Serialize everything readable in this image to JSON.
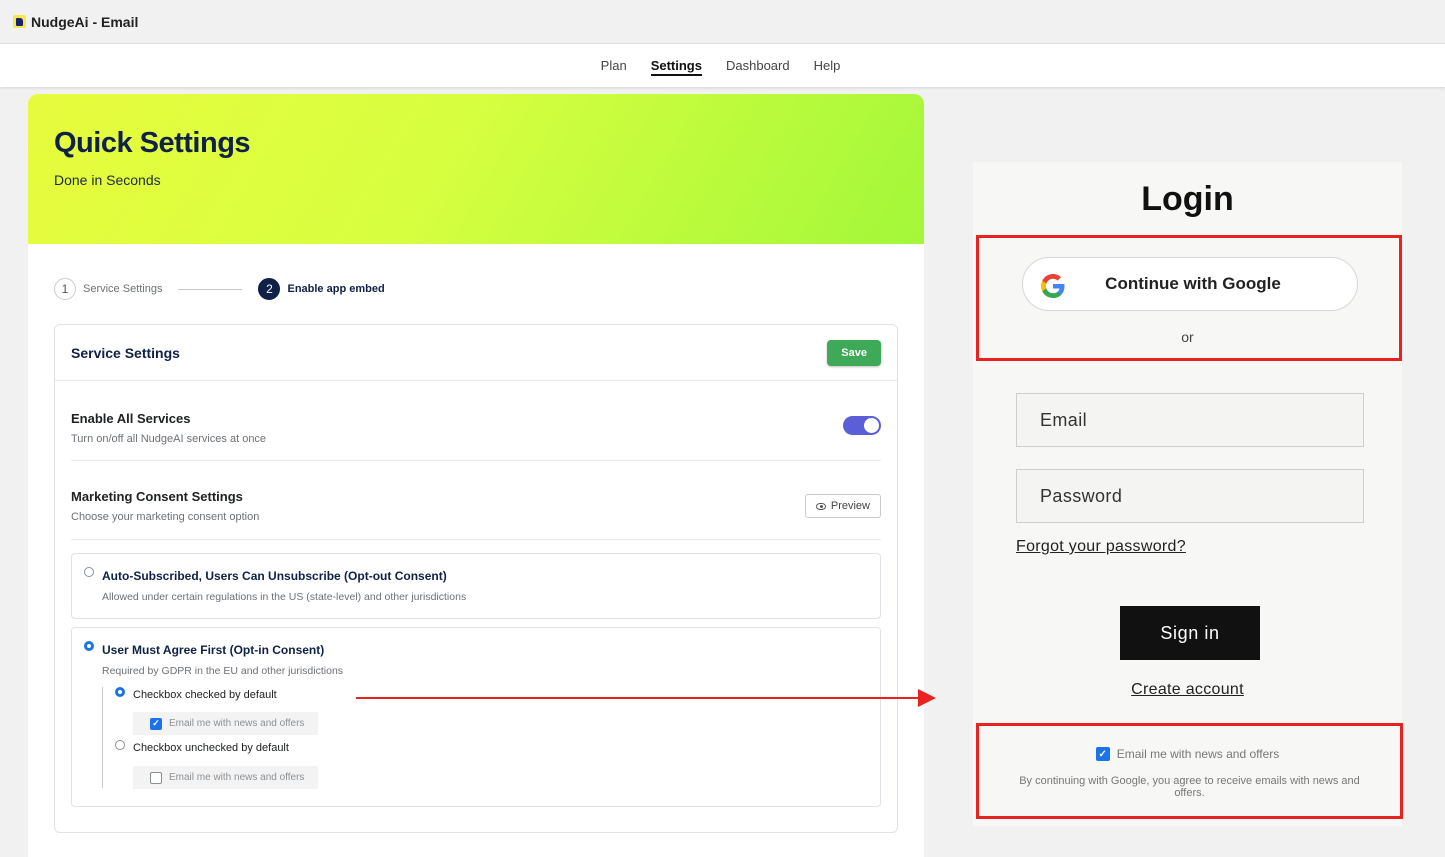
{
  "window": {
    "title": "NudgeAi - Email"
  },
  "nav": {
    "items": [
      {
        "label": "Plan"
      },
      {
        "label": "Settings"
      },
      {
        "label": "Dashboard"
      },
      {
        "label": "Help"
      }
    ],
    "active": "Settings"
  },
  "hero": {
    "title": "Quick Settings",
    "subtitle": "Done in Seconds"
  },
  "stepper": {
    "steps": [
      {
        "number": "1",
        "label": "Service Settings"
      },
      {
        "number": "2",
        "label": "Enable app embed"
      }
    ],
    "current_step": 2
  },
  "service_settings": {
    "title": "Service Settings",
    "save_label": "Save",
    "enable_all": {
      "title": "Enable All Services",
      "description": "Turn on/off all NudgeAI services at once",
      "enabled": true
    },
    "marketing": {
      "title": "Marketing Consent Settings",
      "description": "Choose your marketing consent option",
      "preview_label": "Preview"
    },
    "options": [
      {
        "title": "Auto-Subscribed, Users Can Unsubscribe (Opt-out Consent)",
        "description": "Allowed under certain regulations in the US (state-level) and other jurisdictions",
        "selected": false
      },
      {
        "title": "User Must Agree First (Opt-in Consent)",
        "description": "Required by GDPR in the EU and other jurisdictions",
        "selected": true,
        "sub_options": [
          {
            "label": "Checkbox checked by default",
            "selected": true,
            "preview_text": "Email me with news and offers",
            "preview_checked": true
          },
          {
            "label": "Checkbox unchecked by default",
            "selected": false,
            "preview_text": "Email me with news and offers",
            "preview_checked": false
          }
        ]
      }
    ]
  },
  "login": {
    "title": "Login",
    "google_label": "Continue with Google",
    "or_label": "or",
    "email_placeholder": "Email",
    "password_placeholder": "Password",
    "forgot_label": "Forgot your password?",
    "signin_label": "Sign in",
    "create_label": "Create account",
    "consent_label": "Email me with news and offers",
    "consent_checked": true,
    "consent_note": "By continuing with Google, you agree to receive emails with news and offers."
  },
  "colors": {
    "accent_navy": "#0f2147",
    "save_green": "#3ea959",
    "toggle_purple": "#5a5fd7",
    "annotation_red": "#e8221e",
    "checkbox_blue": "#1a73e8"
  }
}
